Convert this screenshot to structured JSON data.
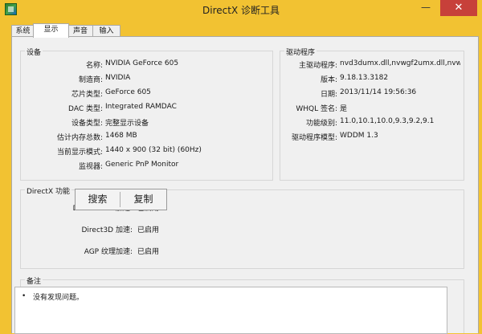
{
  "window": {
    "title": "DirectX 诊断工具",
    "minimize_glyph": "—",
    "close_glyph": "✕"
  },
  "tabs": [
    {
      "label": "系统"
    },
    {
      "label": "显示"
    },
    {
      "label": "声音"
    },
    {
      "label": "输入"
    }
  ],
  "device": {
    "title": "设备",
    "fields": [
      {
        "label": "名称:",
        "value": "NVIDIA GeForce 605"
      },
      {
        "label": "制造商:",
        "value": "NVIDIA"
      },
      {
        "label": "芯片类型:",
        "value": "GeForce 605"
      },
      {
        "label": "DAC 类型:",
        "value": "Integrated RAMDAC"
      },
      {
        "label": "设备类型:",
        "value": "完整显示设备"
      },
      {
        "label": "估计内存总数:",
        "value": "1468 MB"
      },
      {
        "label": "当前显示模式:",
        "value": "1440 x 900 (32 bit) (60Hz)"
      },
      {
        "label": "监视器:",
        "value": "Generic PnP Monitor"
      }
    ]
  },
  "driver": {
    "title": "驱动程序",
    "fields": [
      {
        "label": "主驱动程序:",
        "value": "nvd3dumx.dll,nvwgf2umx.dll,nvwgf2"
      },
      {
        "label": "版本:",
        "value": "9.18.13.3182"
      },
      {
        "label": "日期:",
        "value": "2013/11/14 19:56:36"
      },
      {
        "label": "WHQL 签名:",
        "value": "是"
      },
      {
        "label": "功能级别:",
        "value": "11.0,10.1,10.0,9.3,9.2,9.1"
      },
      {
        "label": "驱动程序模型:",
        "value": "WDDM 1.3"
      }
    ]
  },
  "features": {
    "title": "DirectX 功能",
    "fields": [
      {
        "label": "DirectDraw 加速:",
        "value": "已启用"
      },
      {
        "label": "Direct3D 加速:",
        "value": "已启用"
      },
      {
        "label": "AGP 纹理加速:",
        "value": "已启用"
      }
    ]
  },
  "notes": {
    "title": "备注",
    "items": [
      "没有发现问题。"
    ]
  },
  "overlay": {
    "search_label": "搜索",
    "copy_label": "复制"
  }
}
